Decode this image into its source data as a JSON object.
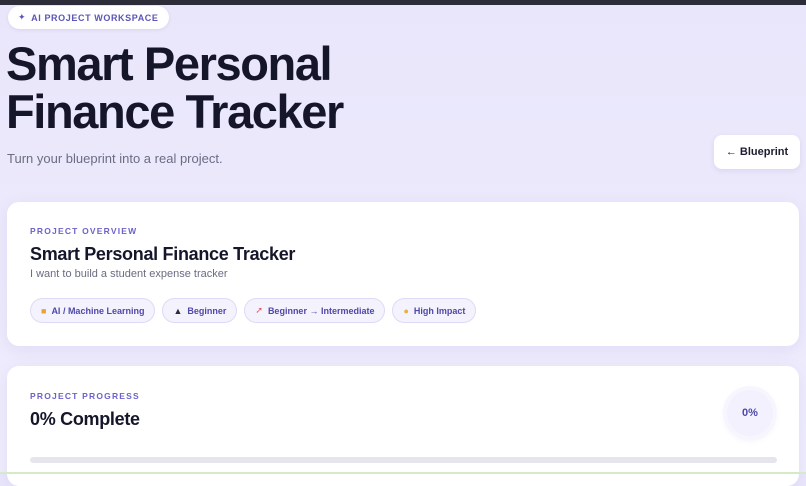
{
  "header": {
    "workspace_tag": "AI PROJECT WORKSPACE",
    "title_line1": "Smart Personal",
    "title_line2": "Finance Tracker",
    "subtitle": "Turn your blueprint into a real project.",
    "back_button": "← Blueprint"
  },
  "overview": {
    "eyebrow": "PROJECT OVERVIEW",
    "title": "Smart Personal Finance Tracker",
    "description": "I want to build a student expense tracker",
    "chips": [
      {
        "icon": "folder-icon",
        "label": "AI / Machine Learning"
      },
      {
        "icon": "graduation-cap-icon",
        "label": "Beginner"
      },
      {
        "icon": "rocket-icon",
        "label": "Beginner → Intermediate"
      },
      {
        "icon": "lightbulb-icon",
        "label": "High Impact"
      }
    ]
  },
  "progress": {
    "eyebrow": "PROJECT PROGRESS",
    "title": "0% Complete",
    "percent_label": "0%",
    "percent_value": 0
  },
  "colors": {
    "accent": "#6b63c9",
    "background": "#ece9fc",
    "card": "#ffffff",
    "text": "#15162a"
  }
}
